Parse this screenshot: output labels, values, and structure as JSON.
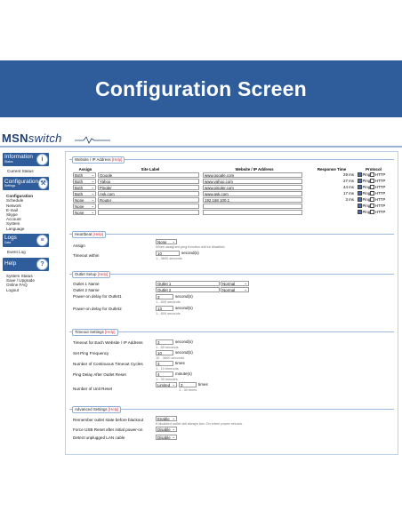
{
  "banner": {
    "title": "Configuration Screen"
  },
  "logo": {
    "brand": "MSN",
    "suffix": "switch"
  },
  "sidebar": {
    "information": {
      "title": "Information",
      "subtitle": "Status",
      "items": [
        "Current Status"
      ]
    },
    "configuration": {
      "title": "Configuration",
      "subtitle": "Settings",
      "active": "Configuration",
      "items": [
        "Schedule",
        "Network",
        "E-mail",
        "Skype",
        "Account",
        "System",
        "Language"
      ]
    },
    "logs": {
      "title": "Logs",
      "subtitle": "Data",
      "items": [
        "Event Log"
      ]
    },
    "help": {
      "title": "Help",
      "items": [
        "System Status",
        "Save / Upgrade",
        "Online FAQ",
        "Logout"
      ]
    }
  },
  "website_panel": {
    "title": "Website / IP Address",
    "help": "[Help]",
    "headers": {
      "assign": "Assign",
      "site": "Site Label",
      "address": "Website / IP Address",
      "response": "Response Time",
      "protocol": "Protocol"
    },
    "rows": [
      {
        "assign": "Both",
        "site": "Google",
        "address": "www.google.com",
        "response": "29 ms",
        "ping": "Ping",
        "http": "HTTP"
      },
      {
        "assign": "Both",
        "site": "Yahoo",
        "address": "www.yahoo.com",
        "response": "27 ms",
        "ping": "Ping",
        "http": "HTTP"
      },
      {
        "assign": "Both",
        "site": "Pingler",
        "address": "www.pingler.com",
        "response": "44 ms",
        "ping": "Ping",
        "http": "HTTP"
      },
      {
        "assign": "Both",
        "site": "Ask.com",
        "address": "www.ask.com",
        "response": "17 ms",
        "ping": "Ping",
        "http": "HTTP"
      },
      {
        "assign": "None",
        "site": "Router",
        "address": "192.168.100.1",
        "response": "3 ms",
        "ping": "Ping",
        "http": "HTTP"
      },
      {
        "assign": "None",
        "site": "",
        "address": "",
        "response": "",
        "ping": "Ping",
        "http": "HTTP"
      },
      {
        "assign": "None",
        "site": "",
        "address": "",
        "response": "",
        "ping": "Ping",
        "http": "HTTP"
      }
    ]
  },
  "heartbeat_panel": {
    "title": "Heartbeat",
    "help": "[Help]",
    "assign_label": "Assign",
    "assign_value": "None",
    "assign_hint": "When assigned ping function will be disabled.",
    "timeout_label": "Timeout within",
    "timeout_value": "10",
    "timeout_unit": "second(s)",
    "timeout_hint": "1 - 3600 seconds"
  },
  "outlet_panel": {
    "title": "Outlet Setup",
    "help": "[Help]",
    "outlet1_label": "Outlet 1 Name",
    "outlet1_value": "Outlet 1",
    "outlet1_mode": "Normal",
    "outlet2_label": "Outlet 2 Name",
    "outlet2_value": "Outlet 2",
    "outlet2_mode": "Normal",
    "delay1_label": "Power-on delay for Outlet1",
    "delay1_value": "3",
    "delay1_unit": "second(s)",
    "delay1_hint": "1 - 600 seconds",
    "delay2_label": "Power-on delay for Outlet2",
    "delay2_value": "13",
    "delay2_unit": "second(s)",
    "delay2_hint": "1 - 600 seconds"
  },
  "timeout_panel": {
    "title": "Timeout Settings",
    "help": "[Help]",
    "t1_label": "Timeout for Each Website / IP Address",
    "t1_value": "3",
    "t1_unit": "second(s)",
    "t1_hint": "1 - 60 seconds",
    "t2_label": "Set Ping Frequency",
    "t2_value": "10",
    "t2_unit": "second(s)",
    "t2_hint": "10 - 3600 seconds",
    "t3_label": "Number of Continuous Timeout Cycles",
    "t3_value": "3",
    "t3_unit": "times",
    "t3_hint": "1 - 10 timeouts",
    "t4_label": "Ping Delay After Outlet Reset",
    "t4_value": "4",
    "t4_unit": "minute(s)",
    "t4_hint": "1 - 30 minutes",
    "t5_label": "Number of Unit Reset",
    "t5_mode": "Limited",
    "t5_value": "3",
    "t5_unit": "times",
    "t5_hint": "1 - 30 times"
  },
  "advanced_panel": {
    "title": "Advanced Settings",
    "help": "[Help]",
    "a1_label": "Remember outlet state before blackout",
    "a1_value": "Enable",
    "a1_hint": "If disabled outlet will always turn On when power returns.",
    "a2_label": "Force USB Reset after initial power-on",
    "a2_value": "Disable",
    "a3_label": "Detect unplugged LAN cable",
    "a3_value": "Disable"
  }
}
